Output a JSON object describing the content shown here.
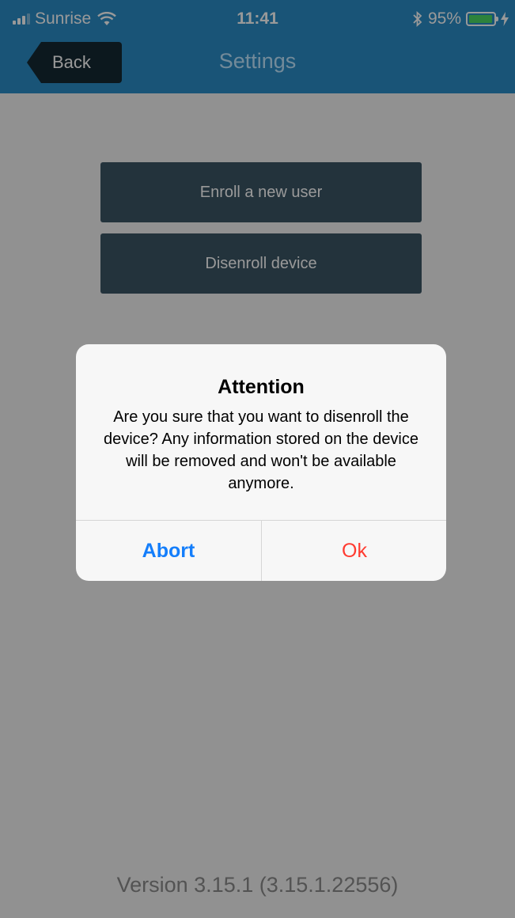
{
  "status_bar": {
    "carrier": "Sunrise",
    "time": "11:41",
    "battery_percent": "95%",
    "battery_level": 0.95,
    "icons": [
      "signal-icon",
      "wifi-icon",
      "bluetooth-icon",
      "battery-icon",
      "charging-icon"
    ]
  },
  "nav": {
    "back_label": "Back",
    "title": "Settings"
  },
  "main": {
    "enroll_label": "Enroll a new user",
    "disenroll_label": "Disenroll device",
    "version": "Version 3.15.1 (3.15.1.22556)"
  },
  "alert": {
    "title": "Attention",
    "message": "Are you sure that you want to disenroll the device? Any information stored on the device will be removed and won't be available anymore.",
    "abort_label": "Abort",
    "ok_label": "Ok"
  },
  "colors": {
    "nav_background": "#2a8cc7",
    "action_button": "#3b5565",
    "abort": "#147efb",
    "ok": "#ff3b30",
    "battery_fill": "#4cd964"
  }
}
